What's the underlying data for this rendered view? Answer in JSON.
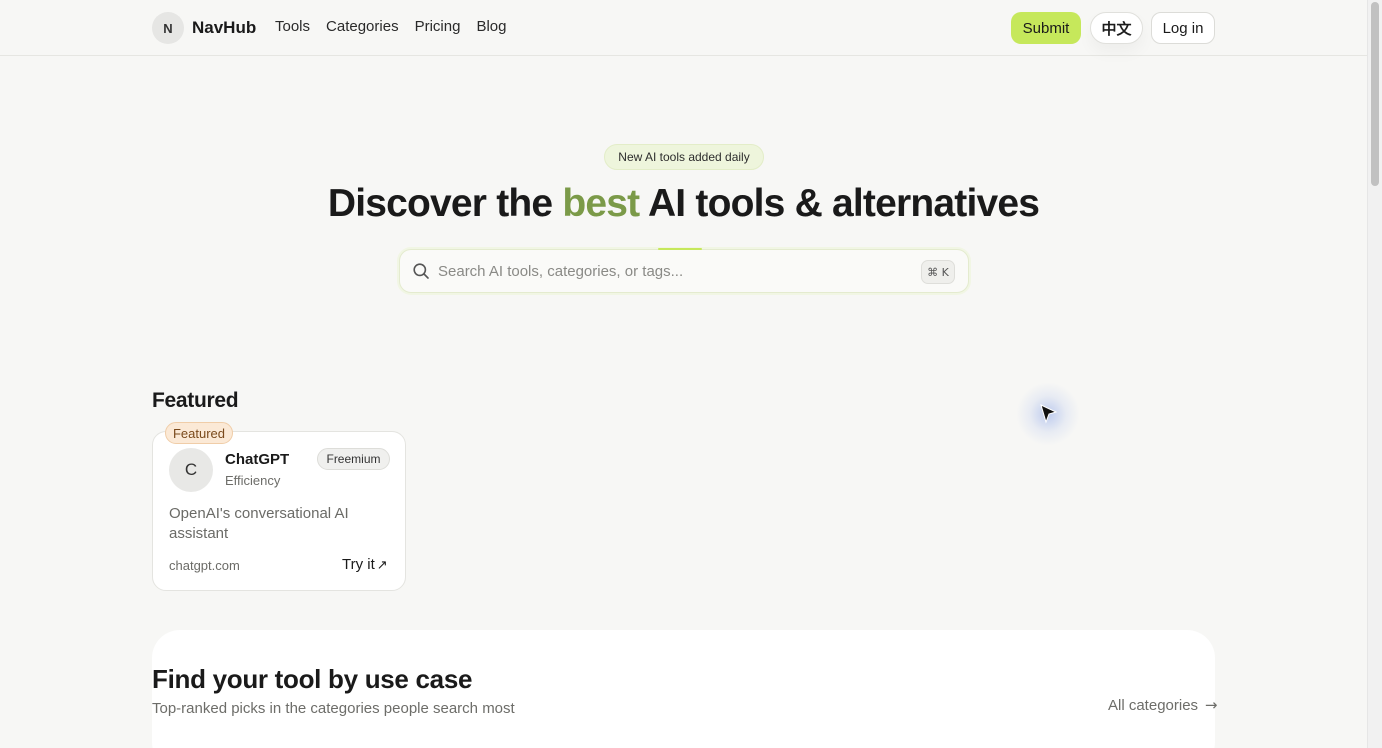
{
  "header": {
    "logo_letter": "N",
    "brand": "NavHub",
    "nav": [
      "Tools",
      "Categories",
      "Pricing",
      "Blog"
    ],
    "submit_label": "Submit",
    "lang_label": "中文",
    "login_label": "Log in"
  },
  "hero": {
    "pill": "New AI tools added daily",
    "title_before": "Discover the ",
    "title_accent": "best",
    "title_after": " AI tools & alternatives",
    "accent_color": "#7b9a48",
    "search_placeholder": "Search AI tools, categories, or tags...",
    "search_value": "",
    "shortcut": "⌘ K"
  },
  "featured": {
    "title": "Featured",
    "card": {
      "tag": "Featured",
      "avatar_letter": "C",
      "name": "ChatGPT",
      "category": "Efficiency",
      "pricing": "Freemium",
      "description": "OpenAI's conversational AI assistant",
      "domain": "chatgpt.com",
      "cta": "Try it",
      "cta_icon": "arrow-up-right-icon"
    }
  },
  "usecase": {
    "title": "Find your tool by use case",
    "subtitle": "Top-ranked picks in the categories people search most",
    "all_link": "All categories",
    "all_link_icon": "arrow-right-icon"
  },
  "colors": {
    "primary_button": "#c6e85b",
    "background": "#f7f7f5",
    "featured_tag": "#fbe9d6"
  }
}
